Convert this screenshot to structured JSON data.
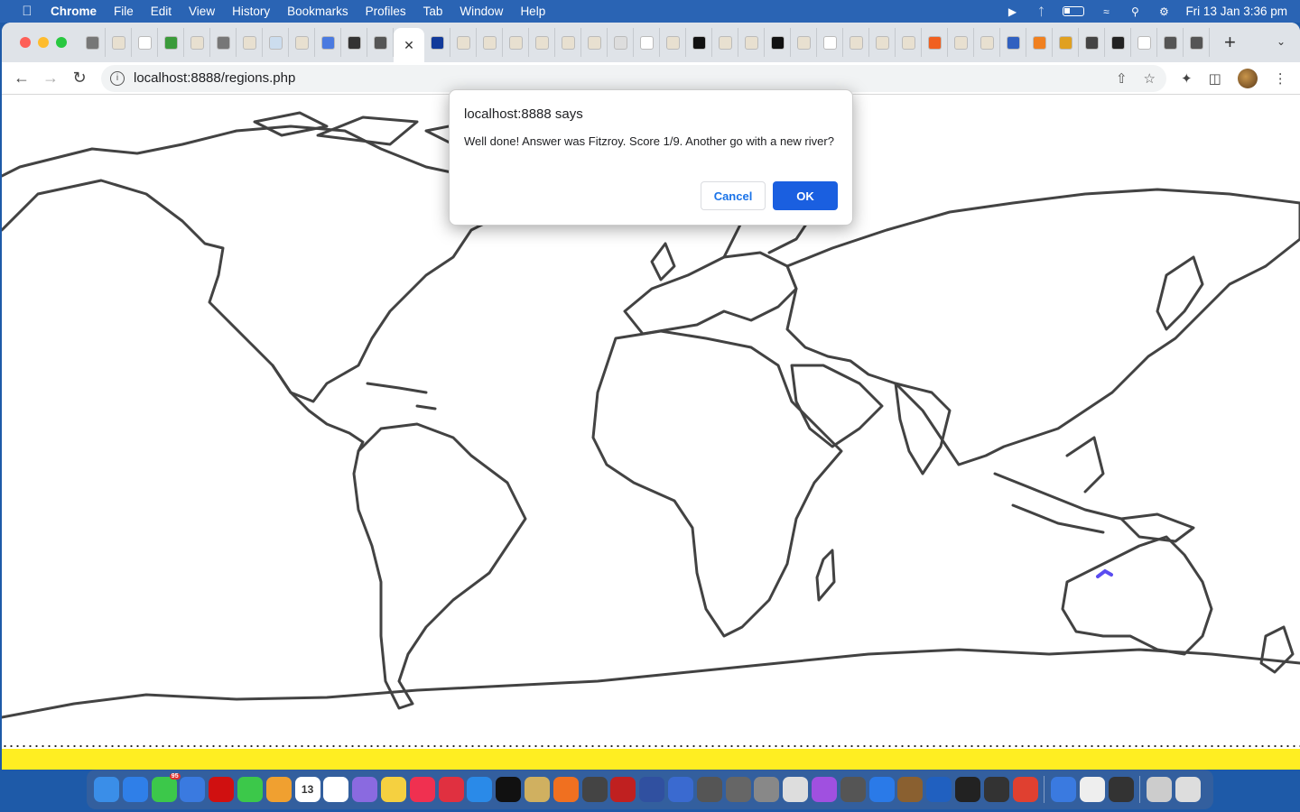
{
  "menubar": {
    "app": "Chrome",
    "items": [
      "File",
      "Edit",
      "View",
      "History",
      "Bookmarks",
      "Profiles",
      "Tab",
      "Window",
      "Help"
    ],
    "clock": "Fri 13 Jan  3:36 pm"
  },
  "browser": {
    "url": "localhost:8888/regions.php",
    "active_tab_close": "✕",
    "new_tab": "+"
  },
  "dialog": {
    "title": "localhost:8888 says",
    "message": "Well done!  Answer was Fitzroy. Score 1/9.  Another go with a new river?",
    "cancel_label": "Cancel",
    "ok_label": "OK"
  },
  "colors": {
    "river_highlight": "#5a4cf0",
    "footer_strip": "#ffee22",
    "ok_button": "#1a5fe0"
  },
  "dock": {
    "calendar_day": "13",
    "messages_badge": "95"
  }
}
